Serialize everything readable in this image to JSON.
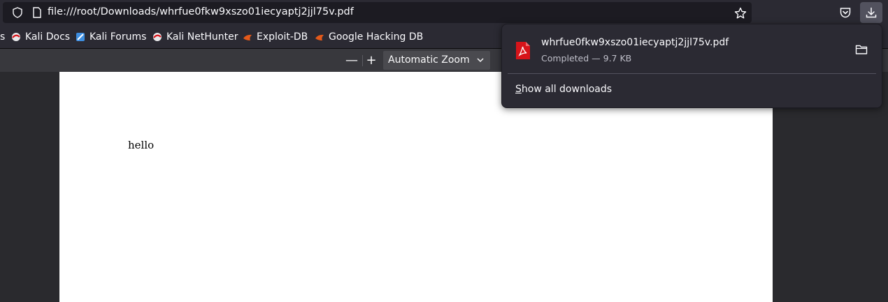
{
  "url_bar": {
    "url": "file:///root/Downloads/whrfue0fkw9xszo01iecyaptj2jjl75v.pdf",
    "left_icons": [
      "shield-icon",
      "page-icon"
    ],
    "right_icons": [
      "star-icon",
      "pocket-icon",
      "downloads-icon"
    ]
  },
  "bookmarks": [
    {
      "label": "s",
      "icon": "none"
    },
    {
      "label": "Kali Docs",
      "icon": "kali-icon"
    },
    {
      "label": "Kali Forums",
      "icon": "kali-forums-icon"
    },
    {
      "label": "Kali NetHunter",
      "icon": "kali-icon"
    },
    {
      "label": "Exploit-DB",
      "icon": "exploit-db-icon"
    },
    {
      "label": "Google Hacking DB",
      "icon": "exploit-db-icon"
    }
  ],
  "pdf_toolbar": {
    "zoom_out": "—",
    "zoom_in": "+",
    "zoom_value": "Automatic Zoom"
  },
  "document": {
    "text": "hello"
  },
  "downloads_panel": {
    "file_name": "whrfue0fkw9xszo01iecyaptj2jjl75v.pdf",
    "status": "Completed — 9.7 KB",
    "show_all_accesskey": "S",
    "show_all_rest": "how all downloads"
  },
  "colors": {
    "accent_pdf": "#d7141a",
    "exploit_db": "#e4591a",
    "panel_bg": "#2b2a33"
  }
}
